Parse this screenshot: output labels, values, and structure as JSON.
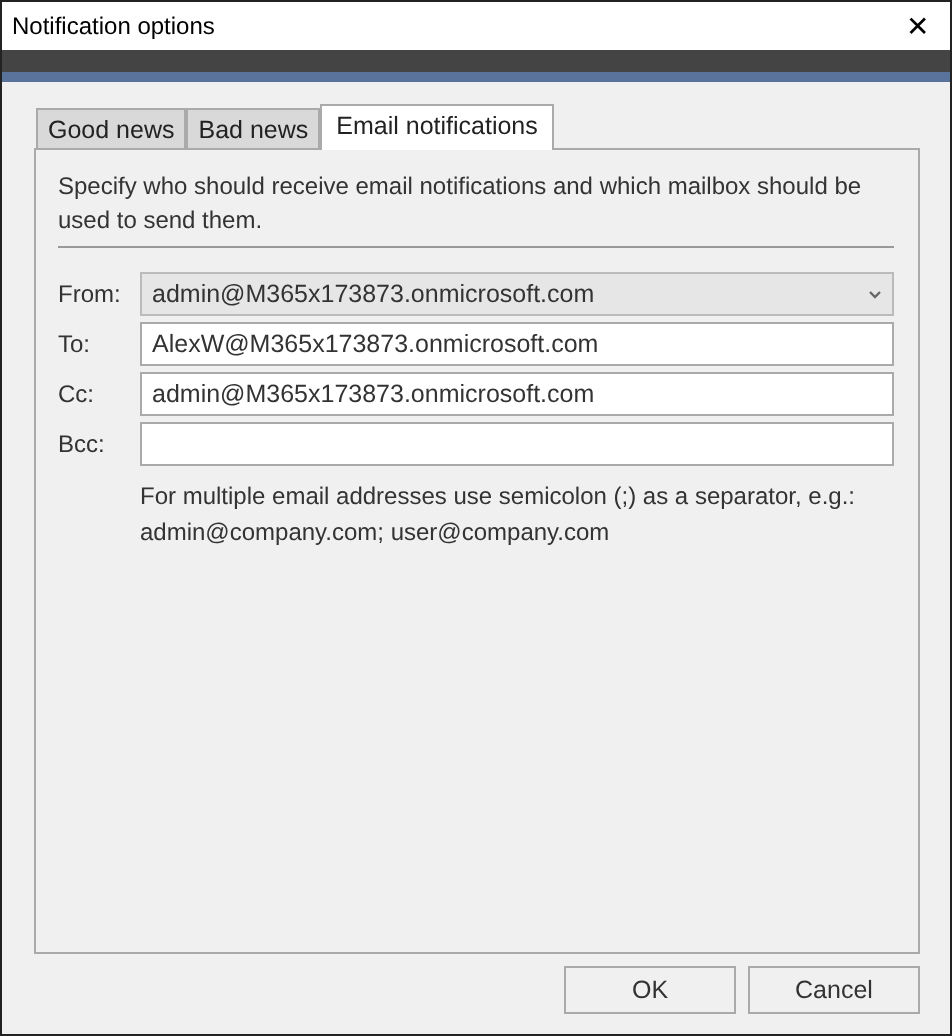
{
  "window": {
    "title": "Notification options",
    "close": "✕"
  },
  "tabs": [
    {
      "label": "Good news",
      "selected": false
    },
    {
      "label": "Bad news",
      "selected": false
    },
    {
      "label": "Email notifications",
      "selected": true
    }
  ],
  "description": "Specify who should receive email notifications and which mailbox should be used to send them.",
  "fields": [
    {
      "label": "From:",
      "kind": "dropdown",
      "value": "admin@M365x173873.onmicrosoft.com"
    },
    {
      "label": "To:",
      "kind": "text",
      "value": "AlexW@M365x173873.onmicrosoft.com"
    },
    {
      "label": "Cc:",
      "kind": "text",
      "value": "admin@M365x173873.onmicrosoft.com"
    },
    {
      "label": "Bcc:",
      "kind": "text"
    }
  ],
  "hint": "For multiple email addresses use semicolon (;) as a separator, e.g.: admin@company.com; user@company.com",
  "buttons": [
    "OK",
    "Cancel"
  ]
}
